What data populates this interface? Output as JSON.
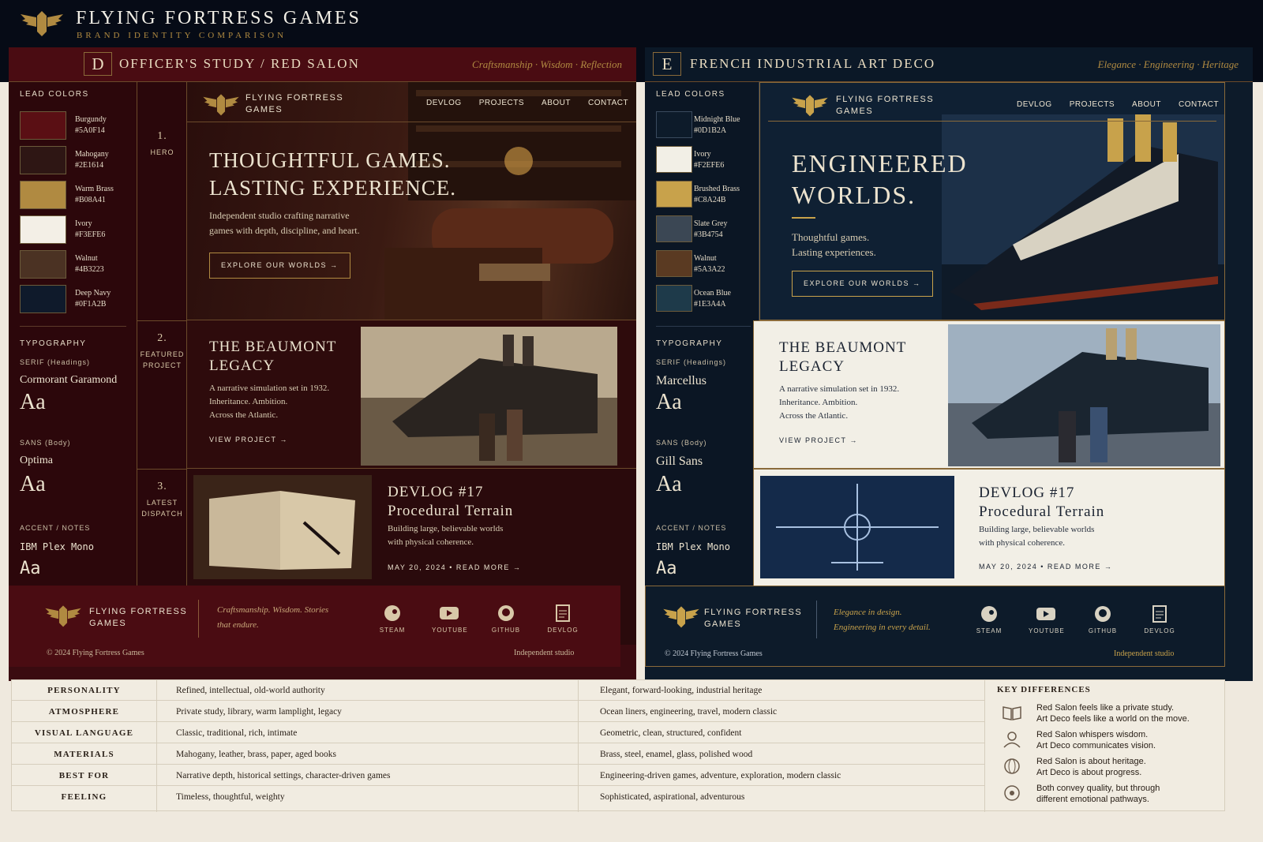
{
  "header": {
    "title": "FLYING FORTRESS GAMES",
    "subtitle": "BRAND IDENTITY COMPARISON"
  },
  "colors": {
    "burgundy": "#5A0F14",
    "mahogany": "#2E1614",
    "brass": "#B08A41",
    "ivory": "#F3EFE6",
    "walnut": "#4B3223",
    "navy": "#0F1A2B",
    "midnight": "#0D1B2A",
    "ivory_e": "#F2EFE6",
    "brushed_brass": "#C8A24B",
    "slate": "#3B4754",
    "walnut_e": "#5A3A22",
    "ocean": "#1E3A4A"
  },
  "panelD": {
    "letter": "D",
    "title": "OFFICER'S STUDY / RED SALON",
    "tags": "Craftsmanship  ·  Wisdom  ·  Reflection",
    "lead_colors": "LEAD COLORS",
    "swatches": [
      {
        "name": "Burgundy",
        "hex": "#5A0F14"
      },
      {
        "name": "Mahogany",
        "hex": "#2E1614"
      },
      {
        "name": "Warm Brass",
        "hex": "#B08A41"
      },
      {
        "name": "Ivory",
        "hex": "#F3EFE6"
      },
      {
        "name": "Walnut",
        "hex": "#4B3223"
      },
      {
        "name": "Deep Navy",
        "hex": "#0F1A2B"
      }
    ],
    "typography": "TYPOGRAPHY",
    "serif_label": "SERIF (Headings)",
    "serif_font": "Cormorant Garamond",
    "sans_label": "SANS (Body)",
    "sans_font": "Optima",
    "accent_label": "ACCENT / NOTES",
    "accent_font": "IBM Plex Mono",
    "aa": "Aa",
    "steps": [
      {
        "num": "1.",
        "label": "HERO"
      },
      {
        "num": "2.",
        "label": "FEATURED\nPROJECT"
      },
      {
        "num": "3.",
        "label": "LATEST\nDISPATCH"
      }
    ],
    "brand": "FLYING FORTRESS\nGAMES",
    "nav": [
      "DEVLOG",
      "PROJECTS",
      "ABOUT",
      "CONTACT"
    ],
    "hero_title": "THOUGHTFUL GAMES.\nLASTING EXPERIENCE.",
    "hero_sub": "Independent studio crafting narrative\ngames with depth, discipline, and heart.",
    "hero_btn": "EXPLORE OUR WORLDS  →",
    "proj_title": "THE BEAUMONT\nLEGACY",
    "proj_desc": "A narrative simulation set in 1932.\nInheritance. Ambition.\nAcross the Atlantic.",
    "proj_link": "VIEW PROJECT  →",
    "dev_title": "DEVLOG #17\nProcedural Terrain",
    "dev_desc": "Building large, believable worlds\nwith physical coherence.",
    "dev_meta": "MAY 20, 2024   •   READ MORE  →",
    "foot_tag": "Craftsmanship. Wisdom. Stories\nthat endure.",
    "foot_icons": [
      "STEAM",
      "YOUTUBE",
      "GITHUB",
      "DEVLOG"
    ],
    "copyright": "© 2024 Flying Fortress Games",
    "indie": "Independent studio"
  },
  "panelE": {
    "letter": "E",
    "title": "FRENCH INDUSTRIAL ART DECO",
    "tags": "Elegance  ·  Engineering  ·  Heritage",
    "lead_colors": "LEAD COLORS",
    "swatches": [
      {
        "name": "Midnight Blue",
        "hex": "#0D1B2A"
      },
      {
        "name": "Ivory",
        "hex": "#F2EFE6"
      },
      {
        "name": "Brushed Brass",
        "hex": "#C8A24B"
      },
      {
        "name": "Slate Grey",
        "hex": "#3B4754"
      },
      {
        "name": "Walnut",
        "hex": "#5A3A22"
      },
      {
        "name": "Ocean Blue",
        "hex": "#1E3A4A"
      }
    ],
    "typography": "TYPOGRAPHY",
    "serif_label": "SERIF (Headings)",
    "serif_font": "Marcellus",
    "sans_label": "SANS (Body)",
    "sans_font": "Gill Sans",
    "accent_label": "ACCENT / NOTES",
    "accent_font": "IBM Plex Mono",
    "aa": "Aa",
    "brand": "FLYING FORTRESS\nGAMES",
    "nav": [
      "DEVLOG",
      "PROJECTS",
      "ABOUT",
      "CONTACT"
    ],
    "hero_title": "ENGINEERED\nWORLDS.",
    "hero_sub": "Thoughtful games.\nLasting experiences.",
    "hero_btn": "EXPLORE OUR WORLDS  →",
    "proj_title": "THE BEAUMONT\nLEGACY",
    "proj_desc": "A narrative simulation set in 1932.\nInheritance. Ambition.\nAcross the Atlantic.",
    "proj_link": "VIEW PROJECT  →",
    "dev_title": "DEVLOG #17\nProcedural Terrain",
    "dev_desc": "Building large, believable worlds\nwith physical coherence.",
    "dev_meta": "MAY 20, 2024   •   READ MORE  →",
    "foot_tag": "Elegance in design.\nEngineering in every detail.",
    "foot_icons": [
      "STEAM",
      "YOUTUBE",
      "GITHUB",
      "DEVLOG"
    ],
    "copyright": "© 2024 Flying Fortress Games",
    "indie": "Independent studio"
  },
  "comparison": {
    "rows": [
      {
        "key": "PERSONALITY",
        "d": "Refined, intellectual, old-world authority",
        "e": "Elegant, forward-looking, industrial heritage"
      },
      {
        "key": "ATMOSPHERE",
        "d": "Private study, library, warm lamplight, legacy",
        "e": "Ocean liners, engineering, travel, modern classic"
      },
      {
        "key": "VISUAL LANGUAGE",
        "d": "Classic, traditional, rich, intimate",
        "e": "Geometric, clean, structured, confident"
      },
      {
        "key": "MATERIALS",
        "d": "Mahogany, leather, brass, paper, aged books",
        "e": "Brass, steel, enamel, glass, polished wood"
      },
      {
        "key": "BEST FOR",
        "d": "Narrative depth, historical settings, character-driven games",
        "e": "Engineering-driven games, adventure, exploration, modern classic"
      },
      {
        "key": "FEELING",
        "d": "Timeless, thoughtful, weighty",
        "e": "Sophisticated, aspirational, adventurous"
      }
    ],
    "key_title": "KEY DIFFERENCES",
    "key_items": [
      "Red Salon feels like a private study.\nArt Deco feels like a world on the move.",
      "Red Salon whispers wisdom.\nArt Deco communicates vision.",
      "Red Salon is about heritage.\nArt Deco is about progress.",
      "Both convey quality, but through\ndifferent emotional pathways."
    ]
  }
}
